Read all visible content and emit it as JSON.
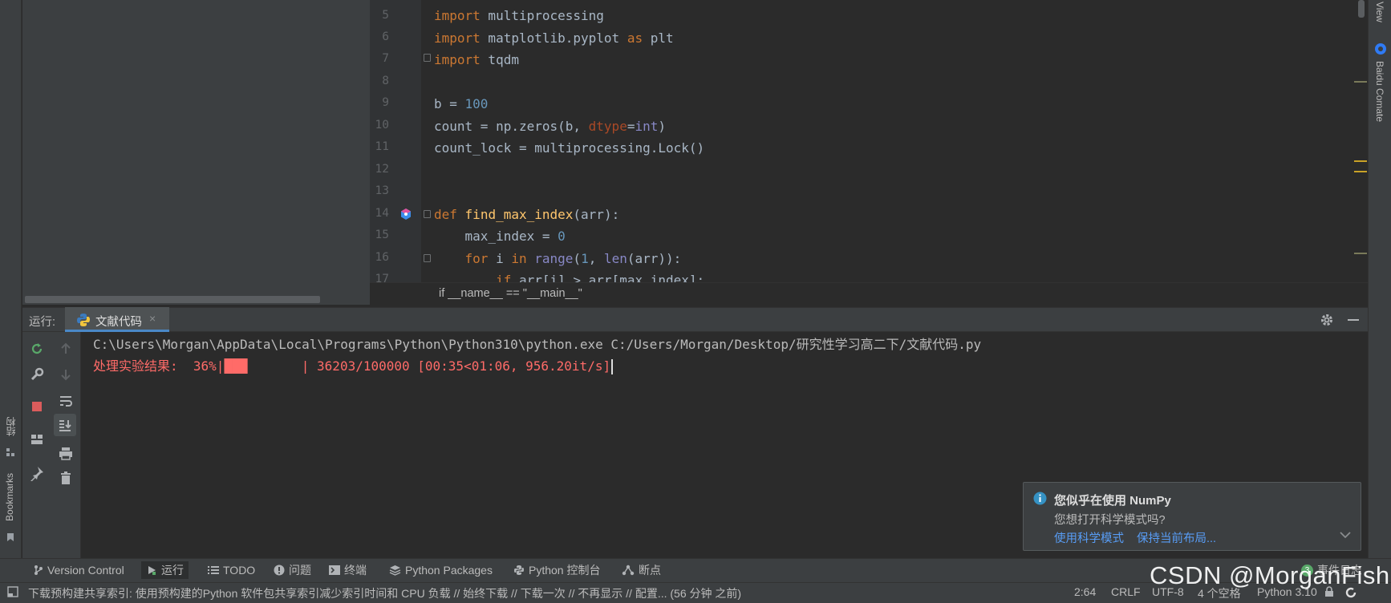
{
  "editor": {
    "lines": [
      {
        "no": "5"
      },
      {
        "no": "6"
      },
      {
        "no": "7"
      },
      {
        "no": "8"
      },
      {
        "no": "9"
      },
      {
        "no": "10"
      },
      {
        "no": "11"
      },
      {
        "no": "12"
      },
      {
        "no": "13"
      },
      {
        "no": "14"
      },
      {
        "no": "15"
      },
      {
        "no": "16"
      },
      {
        "no": "17"
      }
    ],
    "code": {
      "l5_kw": "import",
      "l5_rest": " multiprocessing",
      "l6_kw": "import",
      "l6_mid": " matplotlib.pyplot ",
      "l6_as": "as",
      "l6_rest": " plt",
      "l7_kw": "import",
      "l7_rest": " tqdm",
      "l9_a": "b = ",
      "l9_num": "100",
      "l10_a": "count = np.zeros(b, ",
      "l10_param": "dtype",
      "l10_eq": "=",
      "l10_int": "int",
      "l10_end": ")",
      "l11": "count_lock = multiprocessing.Lock()",
      "l14_kw": "def",
      "l14_sp": " ",
      "l14_fn": "find_max_index",
      "l14_rest": "(arr):",
      "l15_a": "    max_index = ",
      "l15_num": "0",
      "l16_ind": "    ",
      "l16_for": "for",
      "l16_i": " i ",
      "l16_in": "in",
      "l16_sp": " ",
      "l16_range": "range",
      "l16_p": "(",
      "l16_1": "1",
      "l16_c": ", ",
      "l16_len": "len",
      "l16_end": "(arr)):",
      "l17_ind": "        ",
      "l17_if": "if",
      "l17_rest": " arr[i] > arr[max_index]:"
    },
    "breadcrumb": "if __name__ == \"__main__\""
  },
  "run": {
    "label": "运行:",
    "tab_label": "文献代码",
    "tab_close": "×",
    "console_line1": "C:\\Users\\Morgan\\AppData\\Local\\Programs\\Python\\Python310\\python.exe C:/Users/Morgan/Desktop/研究性学习高二下/文献代码.py",
    "progress_prefix": "处理实验结果:  36%|",
    "progress_bar": "███",
    "progress_suffix": "       | 36203/100000 [00:35<01:06, 956.20it/s]",
    "progress_fraction": 0.36
  },
  "left_strip": {
    "structure": "结构",
    "bookmarks": "Bookmarks"
  },
  "right_strip": {
    "view": "View",
    "comate": "Baidu Comate"
  },
  "notification": {
    "title": "您似乎在使用 NumPy",
    "body": "您想打开科学模式吗?",
    "action1": "使用科学模式",
    "action2": "保持当前布局..."
  },
  "tool_windows": {
    "version_control": "Version Control",
    "run": "运行",
    "todo": "TODO",
    "problems": "问题",
    "terminal": "终端",
    "python_packages": "Python Packages",
    "python_console": "Python 控制台",
    "breakpoints": "断点",
    "event_log": "事件日志",
    "event_count": "3"
  },
  "status": {
    "message": "下载预构建共享索引: 使用预构建的Python 软件包共享索引减少索引时间和 CPU 负载 // 始终下载 // 下载一次 // 不再显示 // 配置... (56 分钟 之前)",
    "position": "2:64",
    "line_sep": "CRLF",
    "encoding": "UTF-8",
    "indent": "4 个空格",
    "interpreter": "Python 3.10"
  },
  "watermark": "CSDN @MorganFish",
  "colors": {
    "accent": "#4a88c7",
    "error_text": "#ff6b68",
    "keyword": "#cc7832",
    "number": "#6897bb",
    "function": "#ffc66d"
  }
}
